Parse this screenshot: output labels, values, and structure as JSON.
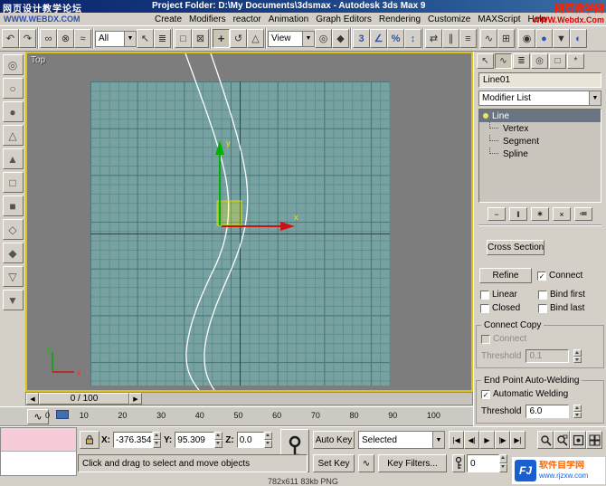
{
  "titlebar": {
    "title": "Project Folder: D:\\My Documents\\3dsmax - Autodesk 3ds Max 9",
    "watermark_line1": "网页设计教学论坛",
    "watermark_line2": "WWW.WEBDX.COM"
  },
  "watermark_right": {
    "line1": "网页教学网",
    "line2": "WWW.Webdx.Com"
  },
  "menubar": {
    "items": [
      {
        "label": "Create"
      },
      {
        "label": "Modifiers"
      },
      {
        "label": "reactor"
      },
      {
        "label": "Animation"
      },
      {
        "label": "Graph Editors"
      },
      {
        "label": "Rendering"
      },
      {
        "label": "Customize"
      },
      {
        "label": "MAXScript"
      },
      {
        "label": "Help"
      }
    ]
  },
  "toolbar": {
    "filter_value": "All",
    "coord_system_value": "View",
    "icons": {
      "undo": "↶",
      "redo": "↷",
      "select_and_link": "∞",
      "unlink": "⊗",
      "bind_spacewarp": "≈",
      "select": "↖",
      "select_by_name": "≣",
      "region": "□",
      "crossing": "⊠",
      "move": "+",
      "rotate": "↺",
      "scale": "△",
      "use_pivot": "◎",
      "manipulate": "◆",
      "snap_3d": "3",
      "snap_angle": "∠",
      "snap_percent": "%",
      "snap_spinner": "↕",
      "mirror": "⇄",
      "align": "∥",
      "layers": "≡",
      "curve_editor": "∿",
      "schematic": "⊞",
      "material_editor": "◉",
      "render_scene": "●",
      "render_type": "▼",
      "quick_render": "◐"
    }
  },
  "left_toolbar": {
    "icons": [
      "◎",
      "○",
      "●",
      "△",
      "▲",
      "□",
      "■",
      "◇",
      "◆",
      "▽",
      "▼"
    ]
  },
  "viewport": {
    "label": "Top",
    "axis_x": "x",
    "axis_y": "y",
    "gizmo_x": "x",
    "gizmo_y": "y"
  },
  "command_panel": {
    "tabs": {
      "create": "↖",
      "modify": "∿",
      "hierarchy": "≣",
      "motion": "◎",
      "display": "□",
      "utilities": "*"
    },
    "object_name": "Line01",
    "modifier_list": "Modifier List",
    "stack": [
      {
        "label": "Line"
      },
      {
        "label": "Vertex"
      },
      {
        "label": "Segment"
      },
      {
        "label": "Spline"
      }
    ],
    "stack_tools": {
      "pin": "−",
      "show_end": "‖",
      "unique": "∗",
      "remove": "×",
      "configure": "≔"
    },
    "cross_section": "Cross Section",
    "refine": "Refine",
    "connect": "Connect",
    "linear": "Linear",
    "closed": "Closed",
    "bind_first": "Bind first",
    "bind_last": "Bind last",
    "connect_copy": {
      "title": "Connect Copy",
      "connect": "Connect",
      "threshold_label": "Threshold",
      "threshold_value": "0.1"
    },
    "end_point_weld": {
      "title": "End Point Auto-Welding",
      "auto_weld": "Automatic Welding",
      "threshold_label": "Threshold",
      "threshold_value": "6.0"
    }
  },
  "time_slider": {
    "value": "0 / 100",
    "left": "◀",
    "right": "▶"
  },
  "track_bar": {
    "ticks": [
      "0",
      "10",
      "20",
      "30",
      "40",
      "50",
      "60",
      "70",
      "80",
      "90",
      "100"
    ],
    "curve_btn": "∿"
  },
  "status_bar": {
    "x_label": "X:",
    "x_value": "-376.354",
    "y_label": "Y:",
    "y_value": "95.309",
    "z_label": "Z:",
    "z_value": "0.0",
    "auto_key": "Auto Key",
    "set_key": "Set Key",
    "selected": "Selected",
    "key_filters": "Key Filters...",
    "tangent_glyph": "∿",
    "frame": "0",
    "prompt": "Click and drag to select and move objects",
    "playback": {
      "go_start": "|◀",
      "prev": "◀|",
      "play": "▶",
      "next": "|▶",
      "go_end": "▶|"
    }
  },
  "ui": {
    "dropdown_arrow": "▼",
    "check": "✓"
  },
  "footer": {
    "image_info": "782x611 83kb PNG",
    "logo_badge": "FJ",
    "logo_title": "软件自学网",
    "logo_url": "www.rjzxw.com"
  }
}
